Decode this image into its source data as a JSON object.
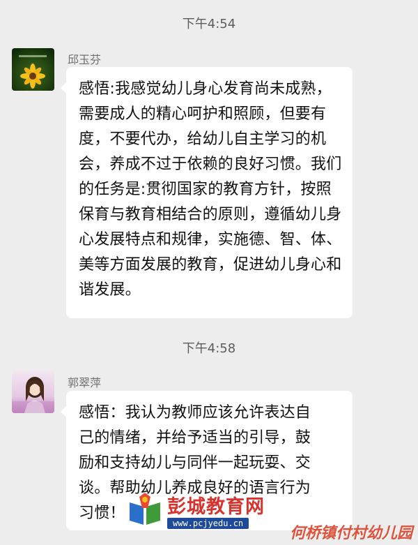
{
  "messages": [
    {
      "time": "下午4:54",
      "sender": "邱玉芬",
      "avatar": "sunflower-avatar",
      "text": "感悟:我感觉幼儿身心发育尚未成熟，需要成人的精心呵护和照顾，但要有度，不要代办，给幼儿自主学习的机会，养成不过于依赖的良好习惯。我们的任务是:贯彻国家的教育方针，按照保育与教育相结合的原则，遵循幼儿身心发展特点和规律，实施德、智、体、美等方面发展的教育，促进幼儿身心和谐发展。"
    },
    {
      "time": "下午4:58",
      "sender": "郭翠萍",
      "avatar": "girl-portrait-avatar",
      "text": "感悟：我认为教师应该允许表达自己的情绪，并给予适当的引导，鼓励和支持幼儿与同伴一起玩耍、交谈。帮助幼儿养成良好的语言行为习惯！"
    }
  ],
  "watermark": {
    "title": "彭城教育网",
    "url": "www.pcjyedu.cn",
    "school": "何桥镇付村幼儿园"
  },
  "colors": {
    "background": "#ededed",
    "bubble": "#ffffff",
    "watermark_red": "#d8322e",
    "watermark_blue": "#1f4a9c"
  }
}
